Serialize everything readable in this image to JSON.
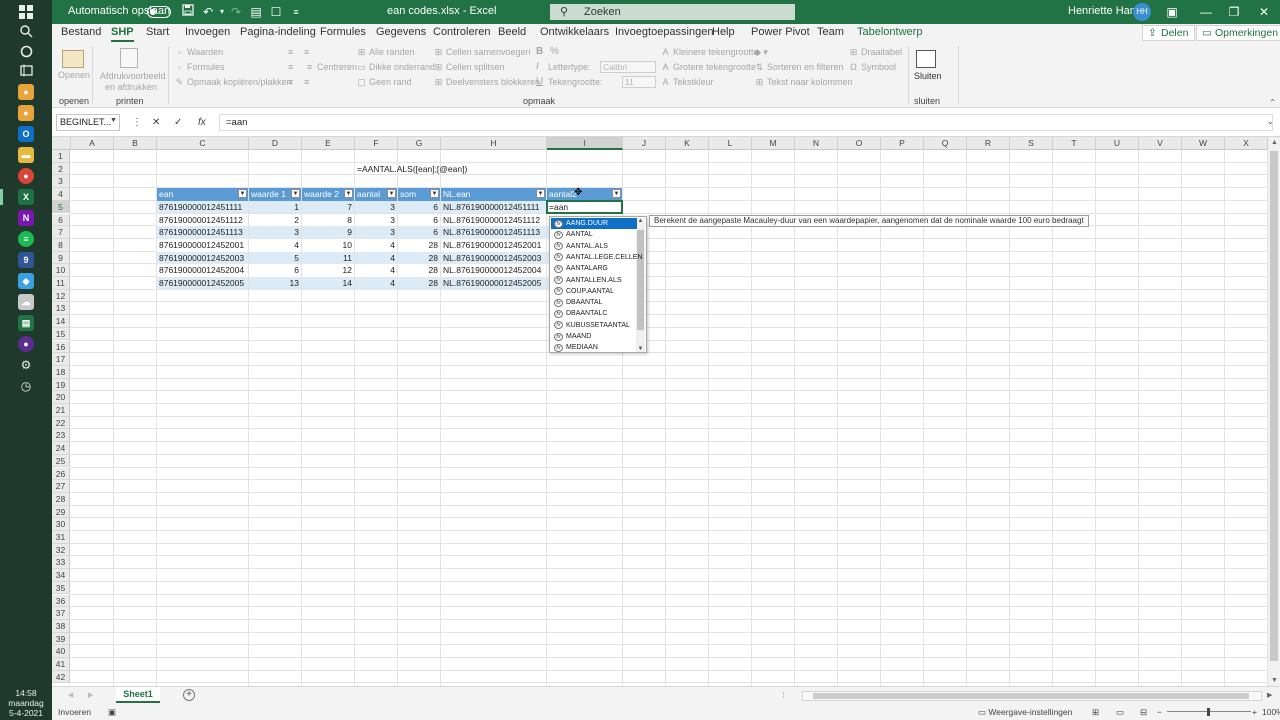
{
  "title_bar": {
    "autosave_label": "Automatisch opslaan",
    "document_title": "ean codes.xlsx  -  Excel",
    "search_placeholder": "Zoeken",
    "user_name": "Henriette Hamer",
    "user_initials": "HH"
  },
  "menu": {
    "tabs": [
      "Bestand",
      "SHP",
      "Start",
      "Invoegen",
      "Pagina-indeling",
      "Formules",
      "Gegevens",
      "Controleren",
      "Beeld",
      "Ontwikkelaars",
      "Invoegtoepassingen",
      "Help",
      "Power Pivot",
      "Team",
      "Tabelontwerp"
    ],
    "active_tab": "SHP",
    "share_label": "Delen",
    "comments_label": "Opmerkingen"
  },
  "ribbon": {
    "open_label": "Openen",
    "print_preview_label": "Afdrukvoorbeeld en afdrukken",
    "values": "Waarden",
    "formulas": "Formules",
    "copy_format": "Opmaak kopiëren/plakken",
    "center": "Centreren",
    "all_borders": "Alle randen",
    "thick_bottom": "Dikke onderrand",
    "no_border": "Geen rand",
    "merge_cells": "Cellen samenvoegen",
    "split_cells": "Cellen splitsen",
    "freeze_panes": "Deelvensters blokkeren",
    "bold": "B",
    "italic": "I",
    "underline": "U",
    "percent": "%",
    "font_label": "Lettertype:",
    "font_value": "Calibri",
    "font_size_label": "Tekengrootte:",
    "font_size_value": "11",
    "smaller_font": "Kleinere tekengrootte",
    "larger_font": "Grotere tekengrootte",
    "font_color": "Tekstkleur",
    "sort_filter": "Sorteren en filteren",
    "text_to_columns": "Tekst naar kolommen",
    "draw_table": "Draaitabel",
    "symbol": "Symbool",
    "close_label": "Sluiten",
    "groups": {
      "open": "openen",
      "print": "printen",
      "format": "opmaak",
      "close": "sluiten"
    }
  },
  "formula_bar": {
    "name_box": "BEGINLET...",
    "formula": "=aan",
    "cancel_glyph": "✕",
    "enter_glyph": "✓",
    "fx_glyph": "fx"
  },
  "sheet": {
    "columns": [
      "A",
      "B",
      "C",
      "D",
      "E",
      "F",
      "G",
      "H",
      "I",
      "J",
      "K",
      "L",
      "M",
      "N",
      "O",
      "P",
      "Q",
      "R",
      "S",
      "T",
      "U",
      "V",
      "W",
      "X"
    ],
    "row_numbers": [
      "1",
      "2",
      "3",
      "4",
      "5",
      "6",
      "7",
      "8",
      "9",
      "10",
      "11",
      "12",
      "13",
      "14",
      "15",
      "16",
      "17",
      "18",
      "19",
      "20",
      "21",
      "22",
      "23",
      "24",
      "25",
      "26",
      "27",
      "28",
      "29",
      "30",
      "31",
      "32",
      "33",
      "34",
      "35",
      "36",
      "37",
      "38",
      "39",
      "40",
      "41",
      "42"
    ],
    "formula_note": "=AANTAL.ALS([ean];[@ean])",
    "table_headers": [
      "ean",
      "waarde 1",
      "waarde 2",
      "aantal",
      "som",
      "NL.ean",
      "aantal2"
    ],
    "table_rows": [
      [
        "876190000012451111",
        "1",
        "7",
        "3",
        "6",
        "NL.876190000012451111"
      ],
      [
        "876190000012451112",
        "2",
        "8",
        "3",
        "6",
        "NL.876190000012451112"
      ],
      [
        "876190000012451113",
        "3",
        "9",
        "3",
        "6",
        "NL.876190000012451113"
      ],
      [
        "876190000012452001",
        "4",
        "10",
        "4",
        "28",
        "NL.876190000012452001"
      ],
      [
        "876190000012452003",
        "5",
        "11",
        "4",
        "28",
        "NL.876190000012452003"
      ],
      [
        "876190000012452004",
        "6",
        "12",
        "4",
        "28",
        "NL.876190000012452004"
      ],
      [
        "876190000012452005",
        "13",
        "14",
        "4",
        "28",
        "NL.876190000012452005"
      ]
    ],
    "editing_value": "=aan"
  },
  "autocomplete": {
    "items": [
      "AANG.DUUR",
      "AANTAL",
      "AANTAL.ALS",
      "AANTAL.LEGE.CELLEN",
      "AANTALARG",
      "AANTALLEN.ALS",
      "COUP.AANTAL",
      "DBAANTAL",
      "DBAANTALC",
      "KUBUSSETAANTAL",
      "MAAND",
      "MEDIAAN"
    ],
    "selected": "AANG.DUUR",
    "tooltip": "Berekent de aangepaste Macauley-duur van een waardepapier, aangenomen dat de nominale waarde 100 euro bedraagt"
  },
  "sheet_tabs": {
    "active": "Sheet1"
  },
  "status": {
    "mode": "Invoeren",
    "display_settings": "Weergave-instellingen",
    "zoom": "100%"
  },
  "taskbar": {
    "time": "14:58",
    "day": "maandag",
    "date": "5-4-2021"
  },
  "colors": {
    "excel_green": "#217346",
    "table_header": "#5b9bd5",
    "table_band": "#ddebf7",
    "autocomplete_highlight": "#0f6fc6"
  }
}
